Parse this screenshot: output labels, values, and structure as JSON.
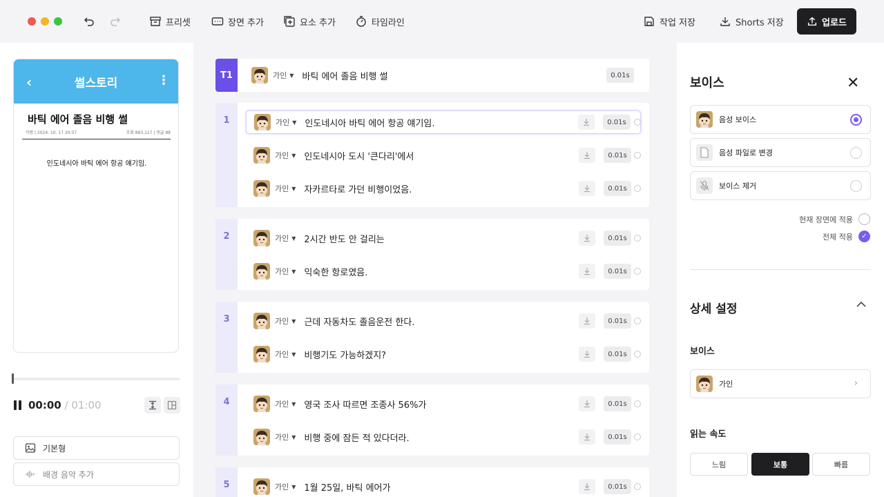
{
  "toolbar": {
    "preset": "프리셋",
    "add_scene": "장면 추가",
    "add_element": "요소 추가",
    "timeline": "타임라인",
    "save": "작업 저장",
    "shorts_save": "Shorts 저장",
    "upload": "업로드"
  },
  "preview": {
    "app_name": "썰스토리",
    "title": "바틱 에어 졸음 비행 썰",
    "meta_left": "익명 | 2024. 10. 17 20:57",
    "meta_right": "조회 883,127 | 댓글 88",
    "body": "인도네시아 바틱 에어 항공 얘기임."
  },
  "player": {
    "current": "00:00",
    "separator": " / ",
    "total": "01:00",
    "progress": 0
  },
  "left_buttons": {
    "template": "기본형",
    "bgm": "배경 음악 추가"
  },
  "scenes": {
    "title": {
      "num": "T1",
      "speaker": "가인",
      "text": "바틱 에어 졸음 비행 썰",
      "dur": "0.01s"
    },
    "s1": {
      "num": "1",
      "lines": [
        {
          "speaker": "가인",
          "text": "인도네시아 바틱 에어 항공 얘기임.",
          "dur": "0.01s"
        },
        {
          "speaker": "가인",
          "text": "인도네시아 도시 '큰다리'에서",
          "dur": "0.01s"
        },
        {
          "speaker": "가인",
          "text": "자카르타로 가던 비행이었음.",
          "dur": "0.01s"
        }
      ]
    },
    "s2": {
      "num": "2",
      "lines": [
        {
          "speaker": "가인",
          "text": "2시간 반도 안 걸리는",
          "dur": "0.01s"
        },
        {
          "speaker": "가인",
          "text": "익숙한 항로였음.",
          "dur": "0.01s"
        }
      ]
    },
    "s3": {
      "num": "3",
      "lines": [
        {
          "speaker": "가인",
          "text": "근데 자동차도 졸음운전 한다.",
          "dur": "0.01s"
        },
        {
          "speaker": "가인",
          "text": "비행기도 가능하겠지?",
          "dur": "0.01s"
        }
      ]
    },
    "s4": {
      "num": "4",
      "lines": [
        {
          "speaker": "가인",
          "text": "영국 조사 따르면 조종사 56%가",
          "dur": "0.01s"
        },
        {
          "speaker": "가인",
          "text": "비행 중에 잠든 적 있다더라.",
          "dur": "0.01s"
        }
      ]
    },
    "s5": {
      "num": "5",
      "lines": [
        {
          "speaker": "가인",
          "text": "1월 25일, 바틱 에어가",
          "dur": "0.01s"
        }
      ]
    }
  },
  "voice_panel": {
    "title": "보이스",
    "options": [
      "음성 보이스",
      "음성 파일로 변경",
      "보이스 제거"
    ],
    "selected_option": "음성 보이스",
    "apply_current": "현재 장면에 적용",
    "apply_all": "전체 적용",
    "detail_title": "상세 설정",
    "voice_label": "보이스",
    "voice_value": "가인",
    "speed_label": "읽는 속도",
    "speeds": [
      "느림",
      "보통",
      "빠름"
    ],
    "selected_speed": "보통"
  },
  "colors": {
    "accent": "#6a4fe8",
    "scene_bg": "#ecebfb",
    "phone_header": "#4db6ea",
    "dark_button": "#1f1f22"
  }
}
